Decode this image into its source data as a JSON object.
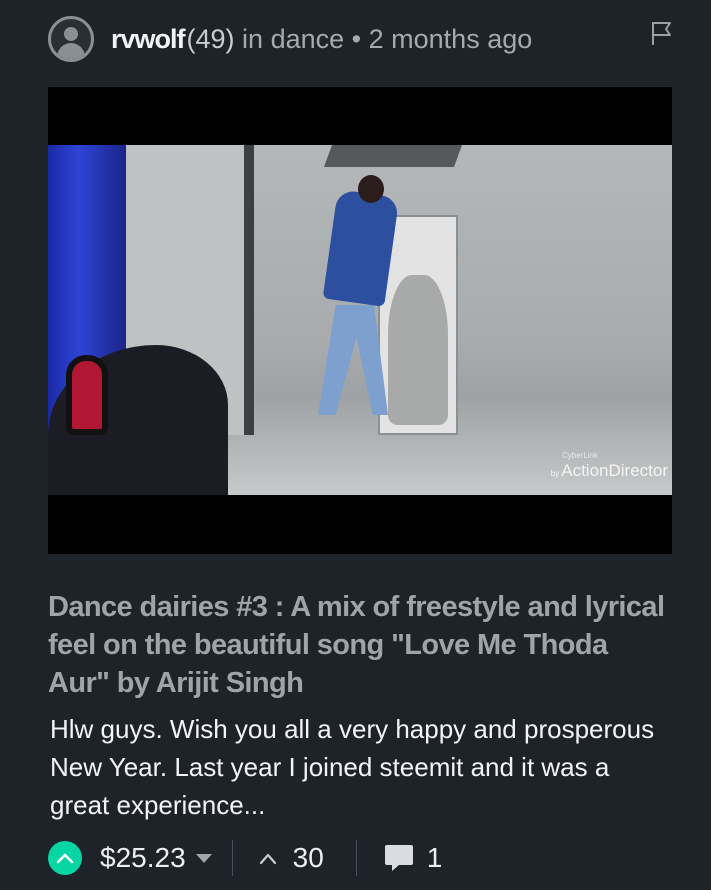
{
  "post": {
    "author": "rvwolf",
    "reputation": "(49)",
    "community_prefix": "in",
    "community": "dance",
    "separator": "•",
    "age": "2 months ago",
    "title": "Dance dairies #3 : A mix of freestyle and lyrical feel on the beautiful song \"Love Me Thoda Aur\" by Arijit Singh",
    "excerpt": "Hlw guys. Wish you all a very happy and prosperous New Year. Last year I joined steemit and it was a great experience...",
    "media": {
      "watermark_small": "CyberLink",
      "watermark_by": "by",
      "watermark_brand": "ActionDirector"
    }
  },
  "footer": {
    "payout": "$25.23",
    "votes": "30",
    "comments": "1"
  },
  "icons": {
    "avatar": "user-avatar-icon",
    "flag": "flag-icon",
    "upvote": "upvote-icon",
    "payout_caret": "caret-down-icon",
    "votes_chevron": "chevron-up-icon",
    "comments": "comment-bubble-icon"
  },
  "colors": {
    "background": "#1e2329",
    "upvote_accent": "#07d6a4",
    "title_text": "#9fa4aa",
    "body_text": "#f3f4f6"
  }
}
